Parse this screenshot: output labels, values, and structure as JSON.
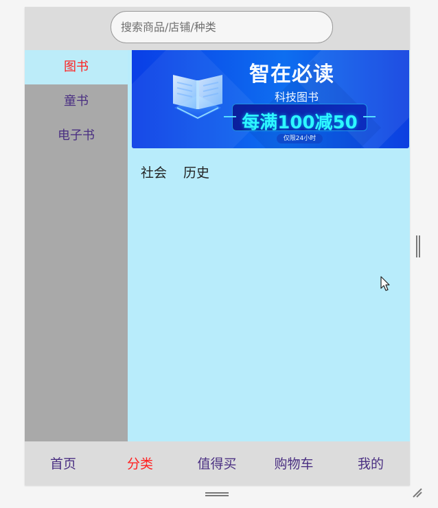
{
  "search": {
    "placeholder": "搜索商品/店铺/种类"
  },
  "sidebar": {
    "items": [
      {
        "label": "图书",
        "active": true
      },
      {
        "label": "童书",
        "active": false
      },
      {
        "label": "电子书",
        "active": false
      }
    ]
  },
  "banner": {
    "title": "智在必读",
    "subtitle": "科技图书",
    "promo": "每满100减50",
    "tag": "仅限24小时"
  },
  "subcategories": [
    {
      "label": "社会"
    },
    {
      "label": "历史"
    }
  ],
  "tabbar": {
    "items": [
      {
        "label": "首页",
        "active": false
      },
      {
        "label": "分类",
        "active": true
      },
      {
        "label": "值得买",
        "active": false
      },
      {
        "label": "购物车",
        "active": false
      },
      {
        "label": "我的",
        "active": false
      }
    ]
  },
  "icons": {
    "banner_book": "book-icon",
    "cursor": "mouse-pointer-icon",
    "scrollbar": "scrollbar-grip-icon",
    "resize": "resize-grip-icon"
  },
  "colors": {
    "accent": "#ff1f1f",
    "sidebar_bg": "#a9a9a9",
    "content_bg": "#b8ecfb",
    "tab_text": "#4a2f82"
  }
}
